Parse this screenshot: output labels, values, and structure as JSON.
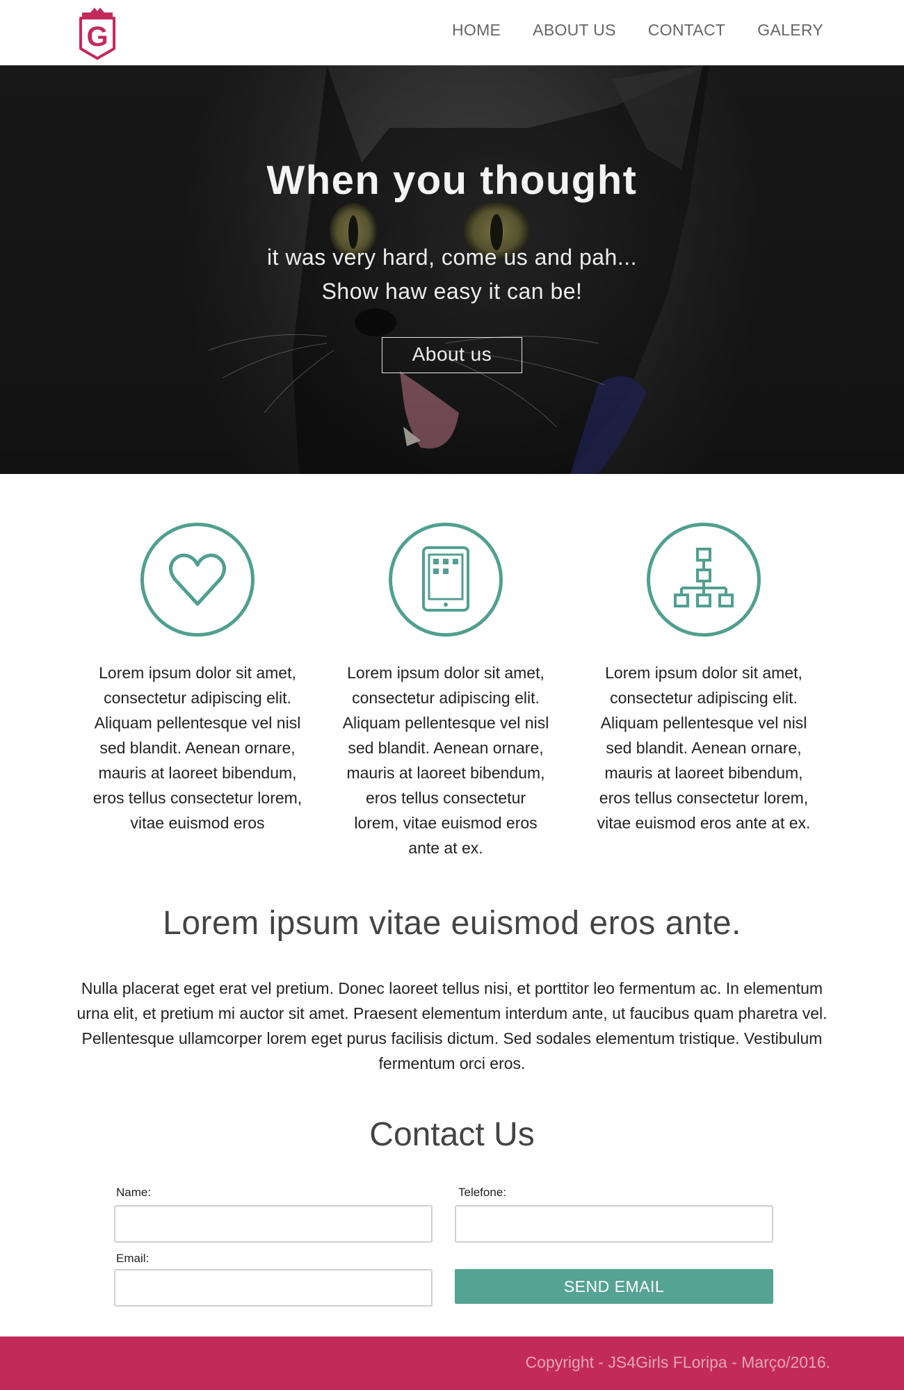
{
  "nav": {
    "items": [
      {
        "label": "HOME"
      },
      {
        "label": "ABOUT US"
      },
      {
        "label": "CONTACT"
      },
      {
        "label": "GALERY"
      }
    ]
  },
  "logo": {
    "icon": "crown-shield-g-logo",
    "letter": "G",
    "color": "#c22b59"
  },
  "hero": {
    "title": "When you thought",
    "subtitle_line1": "it was very hard, come us and pah...",
    "subtitle_line2": "Show haw easy it can be!",
    "button_label": "About us",
    "background": "black-cat-photo"
  },
  "features": [
    {
      "icon": "heart-icon",
      "text": "Lorem ipsum dolor sit amet, consectetur adipiscing elit. Aliquam pellentesque vel nisl sed blandit. Aenean ornare, mauris at laoreet bibendum, eros tellus consectetur lorem, vitae euismod eros"
    },
    {
      "icon": "tablet-icon",
      "text": "Lorem ipsum dolor sit amet, consectetur adipiscing elit. Aliquam pellentesque vel nisl sed blandit. Aenean ornare, mauris at laoreet bibendum, eros tellus consectetur lorem, vitae euismod eros ante at ex."
    },
    {
      "icon": "sitemap-icon",
      "text": "Lorem ipsum dolor sit amet, consectetur adipiscing elit. Aliquam pellentesque vel nisl sed blandit. Aenean ornare, mauris at laoreet bibendum, eros tellus consectetur lorem, vitae euismod eros ante at ex."
    }
  ],
  "section": {
    "title": "Lorem ipsum vitae euismod eros ante.",
    "text": "Nulla placerat eget erat vel pretium. Donec laoreet tellus nisi, et porttitor leo fermentum ac. In elementum urna elit, et pretium mi auctor sit amet. Praesent elementum interdum ante, ut faucibus quam pharetra vel. Pellentesque ullamcorper lorem eget purus facilisis dictum. Sed sodales elementum tristique. Vestibulum fermentum orci eros."
  },
  "contact": {
    "title": "Contact Us",
    "name_label": "Name:",
    "name_value": "",
    "phone_label": "Telefone:",
    "phone_value": "",
    "email_label": "Email:",
    "email_value": "",
    "send_label": "SEND EMAIL"
  },
  "footer": {
    "copyright": "Copyright - JS4Girls FLoripa - Março/2016."
  },
  "colors": {
    "accent": "#54a393",
    "brand": "#c22b59",
    "icon_stroke": "#509f91"
  }
}
